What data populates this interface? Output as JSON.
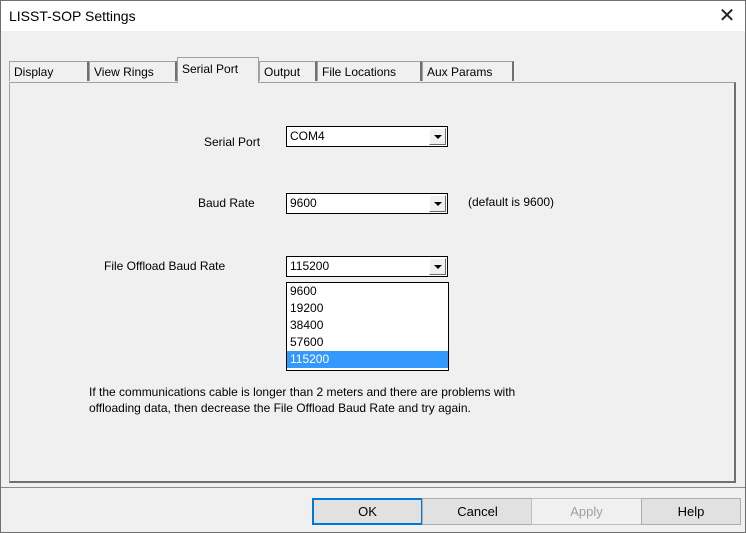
{
  "window": {
    "title": "LISST-SOP Settings",
    "close_glyph": "✕"
  },
  "tabs": [
    {
      "label": "Display"
    },
    {
      "label": "View Rings"
    },
    {
      "label": "Serial Port",
      "active": true
    },
    {
      "label": "Output"
    },
    {
      "label": "File Locations"
    },
    {
      "label": "Aux Params"
    }
  ],
  "serial_port": {
    "label": "Serial Port",
    "value": "COM4"
  },
  "baud_rate": {
    "label": "Baud Rate",
    "value": "9600",
    "hint": "(default is 9600)"
  },
  "offload_baud": {
    "label": "File Offload Baud Rate",
    "value": "115200",
    "options": [
      "9600",
      "19200",
      "38400",
      "57600",
      "115200"
    ],
    "selected_index": 4
  },
  "note": {
    "line1": "If the communications cable is longer than 2 meters and there are problems with",
    "line2": "offloading data, then decrease the File Offload Baud Rate and try again."
  },
  "buttons": {
    "ok": "OK",
    "cancel": "Cancel",
    "apply": "Apply",
    "help": "Help"
  },
  "colors": {
    "selection": "#3399ff",
    "accent": "#0078d7"
  }
}
